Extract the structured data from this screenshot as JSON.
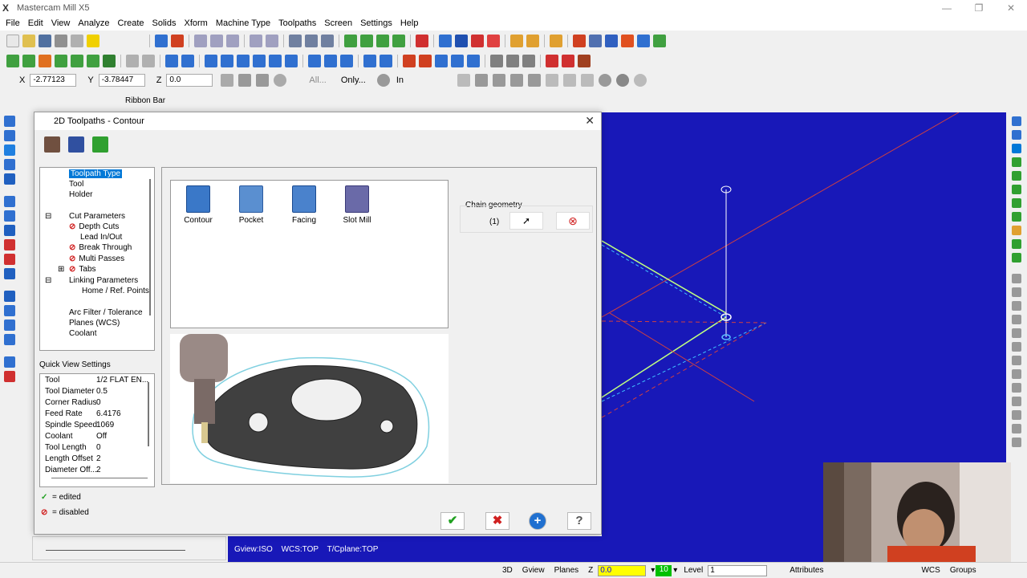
{
  "window": {
    "title": "Mastercam Mill X5",
    "app_icon": "X",
    "controls": [
      "—",
      "❐",
      "✕"
    ]
  },
  "menu": [
    "File",
    "Edit",
    "View",
    "Analyze",
    "Create",
    "Solids",
    "Xform",
    "Machine Type",
    "Toolpaths",
    "Screen",
    "Settings",
    "Help"
  ],
  "ribbon": {
    "x_label": "X",
    "x_value": "-2.77123",
    "y_label": "Y",
    "y_value": "-3.78447",
    "z_label": "Z",
    "z_value": "0.0",
    "all_label": "All...",
    "only_label": "Only...",
    "in_label": "In",
    "ribbon_bar_label": "Ribbon Bar"
  },
  "dialog": {
    "title": "2D Toolpaths - Contour",
    "close": "✕",
    "tree": [
      {
        "label": "Toolpath Type",
        "selected": true
      },
      {
        "label": "Tool"
      },
      {
        "label": "Holder"
      },
      {
        "label": "Cut Parameters"
      },
      {
        "label": "Depth Cuts"
      },
      {
        "label": "Lead In/Out"
      },
      {
        "label": "Break Through"
      },
      {
        "label": "Multi Passes"
      },
      {
        "label": "Tabs"
      },
      {
        "label": "Linking Parameters"
      },
      {
        "label": "Home / Ref. Points"
      },
      {
        "label": "Arc Filter / Tolerance"
      },
      {
        "label": "Planes (WCS)"
      },
      {
        "label": "Coolant"
      }
    ],
    "quick_view_title": "Quick View Settings",
    "quick_view": [
      {
        "k": "Tool",
        "v": "1/2 FLAT EN..."
      },
      {
        "k": "Tool Diameter",
        "v": "0.5"
      },
      {
        "k": "Corner Radius",
        "v": "0"
      },
      {
        "k": "Feed Rate",
        "v": "6.4176"
      },
      {
        "k": "Spindle Speed",
        "v": "1069"
      },
      {
        "k": "Coolant",
        "v": "Off"
      },
      {
        "k": "Tool Length",
        "v": "0"
      },
      {
        "k": "Length Offset",
        "v": "2"
      },
      {
        "k": "Diameter Off...",
        "v": "2"
      }
    ],
    "legend_edited_mark": "✓",
    "legend_edited": "= edited",
    "legend_disabled_mark": "⊘",
    "legend_disabled": "= disabled",
    "toolpath_types": [
      {
        "label": "Contour",
        "color": "#3a78c8"
      },
      {
        "label": "Pocket",
        "color": "#5a8fd0"
      },
      {
        "label": "Facing",
        "color": "#4a82cc"
      },
      {
        "label": "Slot Mill",
        "color": "#6a6aa8"
      }
    ],
    "chain_geometry_label": "Chain geometry",
    "chain_count": "(1)",
    "ok_mark": "✔",
    "cancel_mark": "✖",
    "add_mark": "+",
    "help_mark": "?"
  },
  "viewport": {
    "gview": "Gview:ISO",
    "wcs": "WCS:TOP",
    "tcplane": "T/Cplane:TOP",
    "background": "#1818b8"
  },
  "statusbar": {
    "3d": "3D",
    "gview": "Gview",
    "planes": "Planes",
    "z_label": "Z",
    "z_value": "0.0",
    "level_color_value": "10",
    "level_label": "Level",
    "level_value": "1",
    "attributes": "Attributes",
    "wcs": "WCS",
    "groups": "Groups"
  }
}
